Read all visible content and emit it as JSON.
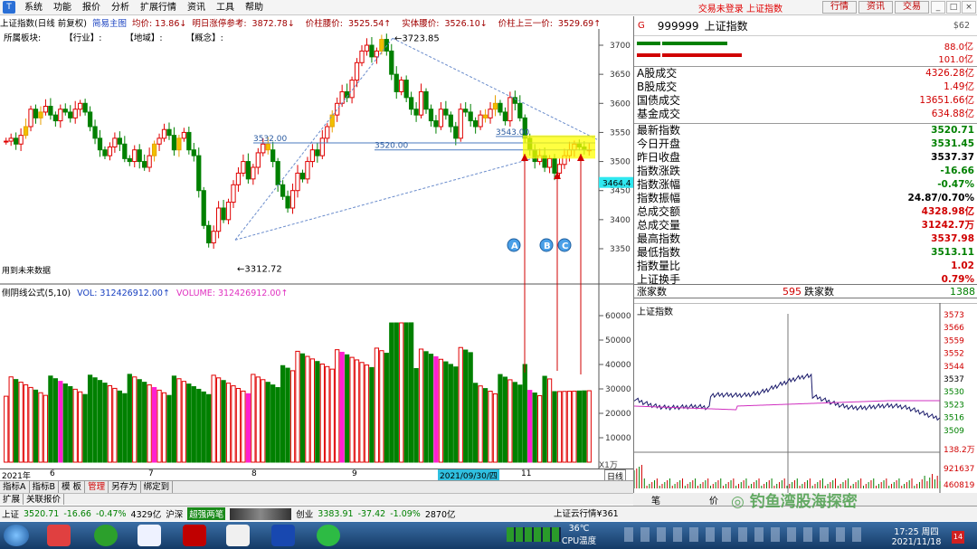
{
  "menu": {
    "items": [
      "系统",
      "功能",
      "报价",
      "分析",
      "扩展行情",
      "资讯",
      "工具",
      "帮助"
    ],
    "status": "交易未登录 上证指数",
    "buttons": [
      "行情",
      "资讯",
      "交易"
    ]
  },
  "info": {
    "title": "上证指数(日线 前复权)",
    "mode": "简易主图",
    "avg": "均价: 13.86↓",
    "limit_ref_label": "明日涨停参考:",
    "limit_ref": "3872.78↓",
    "pivot_label": "价柱腰价:",
    "pivot": "3525.54↑",
    "body_label": "实体腰价:",
    "body": "3526.10↓",
    "prev3_label": "价柱上三一价:",
    "prev3": "3529.69↑"
  },
  "sector": {
    "label": "所属板块:",
    "industry": "【行业】:",
    "region": "【地域】:",
    "concept": "【概念】:"
  },
  "kline": {
    "high_label": "3723.85",
    "low_label": "3312.72",
    "future_label": "用到未来数据",
    "line_a": "3532.00",
    "line_b": "3520.00",
    "line_c": "3543.00",
    "current_tag": "3464.4",
    "yticks": [
      "3700",
      "3650",
      "3600",
      "3550",
      "3500",
      "3450",
      "3400",
      "3350"
    ],
    "markers": [
      "A",
      "B",
      "C"
    ]
  },
  "vol": {
    "title": "侧阴线公式(5,10)",
    "vol_label": "VOL: 312426912.00↑",
    "volume_label": "VOLUME: 312426912.00↑",
    "yticks": [
      "60000",
      "50000",
      "40000",
      "30000",
      "20000",
      "10000"
    ],
    "unit": "X1万"
  },
  "xaxis": {
    "labels": [
      "2021年",
      "6",
      "7",
      "8",
      "9",
      "2021/09/30/四",
      "11"
    ],
    "period": "日线"
  },
  "tabs": {
    "row1": [
      "指标A",
      "指标B",
      "模 板",
      "管理",
      "另存为",
      "绑定到"
    ],
    "row2": [
      "扩展",
      "关联报价"
    ]
  },
  "statusbar": {
    "sh_label": "上证",
    "sh_val": "3520.71",
    "sh_chg": "-16.66",
    "sh_pct": "-0.47%",
    "sh_amt": "4329亿",
    "sz_label": "沪深",
    "brand": "超强两笔",
    "cy_label": "创业",
    "cy_val": "3383.91",
    "cy_chg": "-37.42",
    "cy_pct": "-1.09%",
    "cy_amt": "2870亿",
    "yun": "上证云行情¥361"
  },
  "rightpanel": {
    "code": "999999",
    "name": "上证指数",
    "g": "G",
    "right_tag": "$62",
    "bar_val1": "88.0亿",
    "bar_val2": "101.0亿",
    "turnover": [
      {
        "label": "A股成交",
        "val": "4326.28亿"
      },
      {
        "label": "B股成交",
        "val": "1.49亿"
      },
      {
        "label": "国债成交",
        "val": "13651.66亿"
      },
      {
        "label": "基金成交",
        "val": "634.88亿"
      }
    ],
    "stats": [
      {
        "label": "最新指数",
        "val": "3520.71",
        "c": "green"
      },
      {
        "label": "今日开盘",
        "val": "3531.45",
        "c": "green"
      },
      {
        "label": "昨日收盘",
        "val": "3537.37",
        "c": "black"
      },
      {
        "label": "指数涨跌",
        "val": "-16.66",
        "c": "green"
      },
      {
        "label": "指数涨幅",
        "val": "-0.47%",
        "c": "green"
      },
      {
        "label": "指数振幅",
        "val": "24.87/0.70%",
        "c": "black"
      },
      {
        "label": "总成交额",
        "val": "4328.98亿",
        "c": "red"
      },
      {
        "label": "总成交量",
        "val": "31242.7万",
        "c": "red"
      },
      {
        "label": "最高指数",
        "val": "3537.98",
        "c": "red"
      },
      {
        "label": "最低指数",
        "val": "3513.11",
        "c": "green"
      },
      {
        "label": "指数量比",
        "val": "1.02",
        "c": "red"
      },
      {
        "label": "上证换手",
        "val": "0.79%",
        "c": "red"
      }
    ],
    "adv_label": "涨家数",
    "adv": "595",
    "dec_label": "跌家数",
    "dec": "1388",
    "intraday_title": "上证指数",
    "intraday_yticks": [
      "3573",
      "3566",
      "3559",
      "3552",
      "3544",
      "3537",
      "3530",
      "3523",
      "3516",
      "3509",
      "138.2万",
      "921637",
      "460819"
    ],
    "bottom": [
      "笔",
      "价"
    ]
  },
  "taskbar": {
    "temp": "36℃",
    "cpu": "CPU温度",
    "time": "17:25 周四",
    "date": "2021/11/18",
    "badge": "14"
  },
  "watermark": "钓鱼湾股海探密"
}
